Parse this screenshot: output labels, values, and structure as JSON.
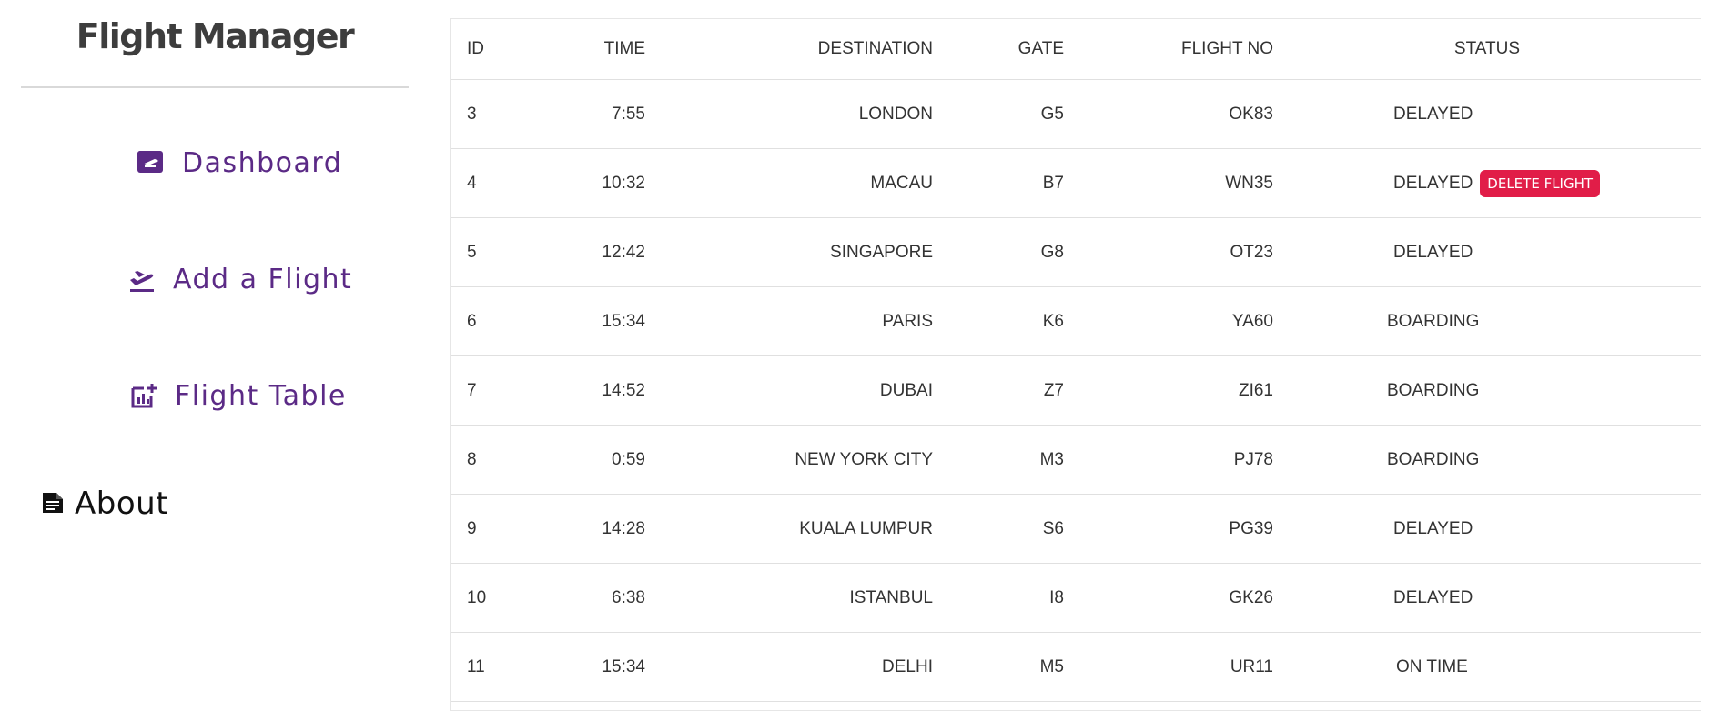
{
  "app": {
    "title": "Flight Manager"
  },
  "nav": {
    "dashboard": "Dashboard",
    "add_flight": "Add a Flight",
    "flight_table": "Flight Table",
    "about": "About"
  },
  "table": {
    "headers": {
      "id": "ID",
      "time": "TIME",
      "destination": "DESTINATION",
      "gate": "GATE",
      "flight_no": "FLIGHT NO",
      "status": "STATUS"
    },
    "rows": [
      {
        "id": "3",
        "time": "7:55",
        "destination": "LONDON",
        "gate": "G5",
        "flight_no": "OK83",
        "status": "DELAYED"
      },
      {
        "id": "4",
        "time": "10:32",
        "destination": "MACAU",
        "gate": "B7",
        "flight_no": "WN35",
        "status": "DELAYED",
        "action": "DELETE FLIGHT"
      },
      {
        "id": "5",
        "time": "12:42",
        "destination": "SINGAPORE",
        "gate": "G8",
        "flight_no": "OT23",
        "status": "DELAYED"
      },
      {
        "id": "6",
        "time": "15:34",
        "destination": "PARIS",
        "gate": "K6",
        "flight_no": "YA60",
        "status": "BOARDING"
      },
      {
        "id": "7",
        "time": "14:52",
        "destination": "DUBAI",
        "gate": "Z7",
        "flight_no": "ZI61",
        "status": "BOARDING"
      },
      {
        "id": "8",
        "time": "0:59",
        "destination": "NEW YORK CITY",
        "gate": "M3",
        "flight_no": "PJ78",
        "status": "BOARDING"
      },
      {
        "id": "9",
        "time": "14:28",
        "destination": "KUALA LUMPUR",
        "gate": "S6",
        "flight_no": "PG39",
        "status": "DELAYED"
      },
      {
        "id": "10",
        "time": "6:38",
        "destination": "ISTANBUL",
        "gate": "I8",
        "flight_no": "GK26",
        "status": "DELAYED"
      },
      {
        "id": "11",
        "time": "15:34",
        "destination": "DELHI",
        "gate": "M5",
        "flight_no": "UR11",
        "status": "ON TIME"
      }
    ]
  },
  "colors": {
    "nav_accent": "#5b2a86",
    "delete_button": "#e11d48"
  },
  "icons": {
    "dashboard": "dashboard-icon",
    "add_flight": "flight-takeoff-icon",
    "flight_table": "add-chart-icon",
    "about": "document-icon"
  }
}
